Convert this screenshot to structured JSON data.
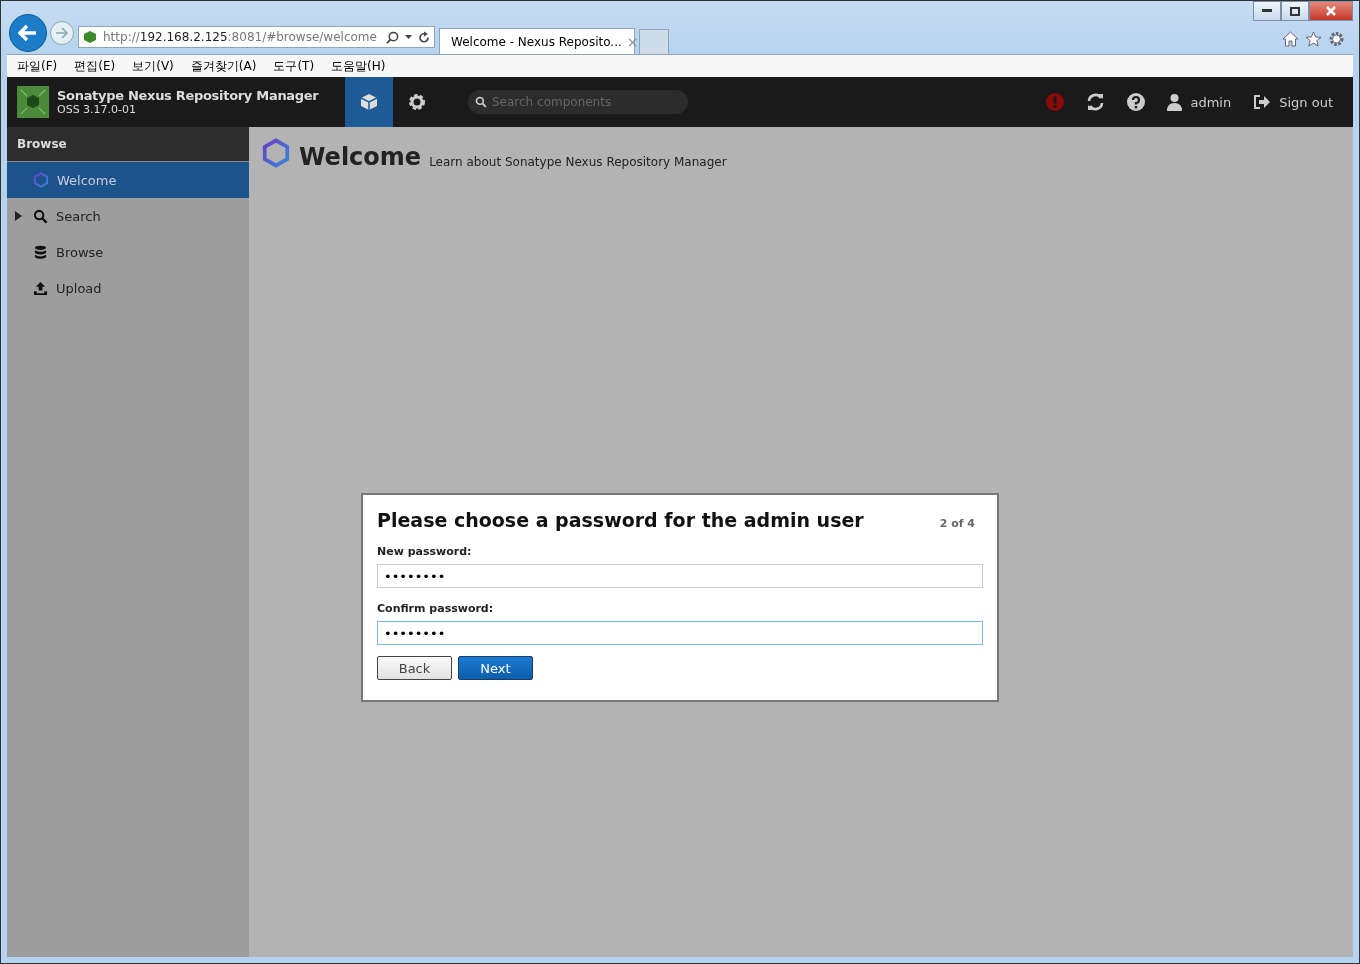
{
  "browser": {
    "address": {
      "prefix": "http://",
      "host": "192.168.2.125",
      "rest": ":8081/#browse/welcome"
    },
    "tabs": [
      {
        "label": "Welcome - Nexus Reposito...",
        "close": "×",
        "selected": true
      }
    ],
    "menu": [
      "파일(F)",
      "편집(E)",
      "보기(V)",
      "즐겨찾기(A)",
      "도구(T)",
      "도움말(H)"
    ]
  },
  "header": {
    "title": "Sonatype Nexus Repository Manager",
    "version": "OSS 3.17.0-01",
    "modes": [
      {
        "kind": "browse",
        "selected": true
      },
      {
        "kind": "admin",
        "selected": false
      }
    ],
    "search": {
      "placeholder": "Search components"
    },
    "user": "admin",
    "signout": "Sign out"
  },
  "sidebar": {
    "title": "Browse",
    "items": [
      {
        "label": "Welcome",
        "kind": "welcome",
        "selected": true,
        "expandable": false
      },
      {
        "label": "Search",
        "kind": "search",
        "selected": false,
        "expandable": true
      },
      {
        "label": "Browse",
        "kind": "browse",
        "selected": false,
        "expandable": false
      },
      {
        "label": "Upload",
        "kind": "upload",
        "selected": false,
        "expandable": false
      }
    ]
  },
  "page": {
    "title": "Welcome",
    "subtitle": "Learn about Sonatype Nexus Repository Manager"
  },
  "dialog": {
    "title": "Please choose a password for the admin user",
    "step": "2 of 4",
    "fields": [
      {
        "label": "New password:",
        "value": "••••••••",
        "focused": false
      },
      {
        "label": "Confirm password:",
        "value": "••••••••",
        "focused": true
      }
    ],
    "buttons": [
      {
        "label": "Back",
        "kind": "secondary"
      },
      {
        "label": "Next",
        "kind": "primary"
      }
    ]
  }
}
